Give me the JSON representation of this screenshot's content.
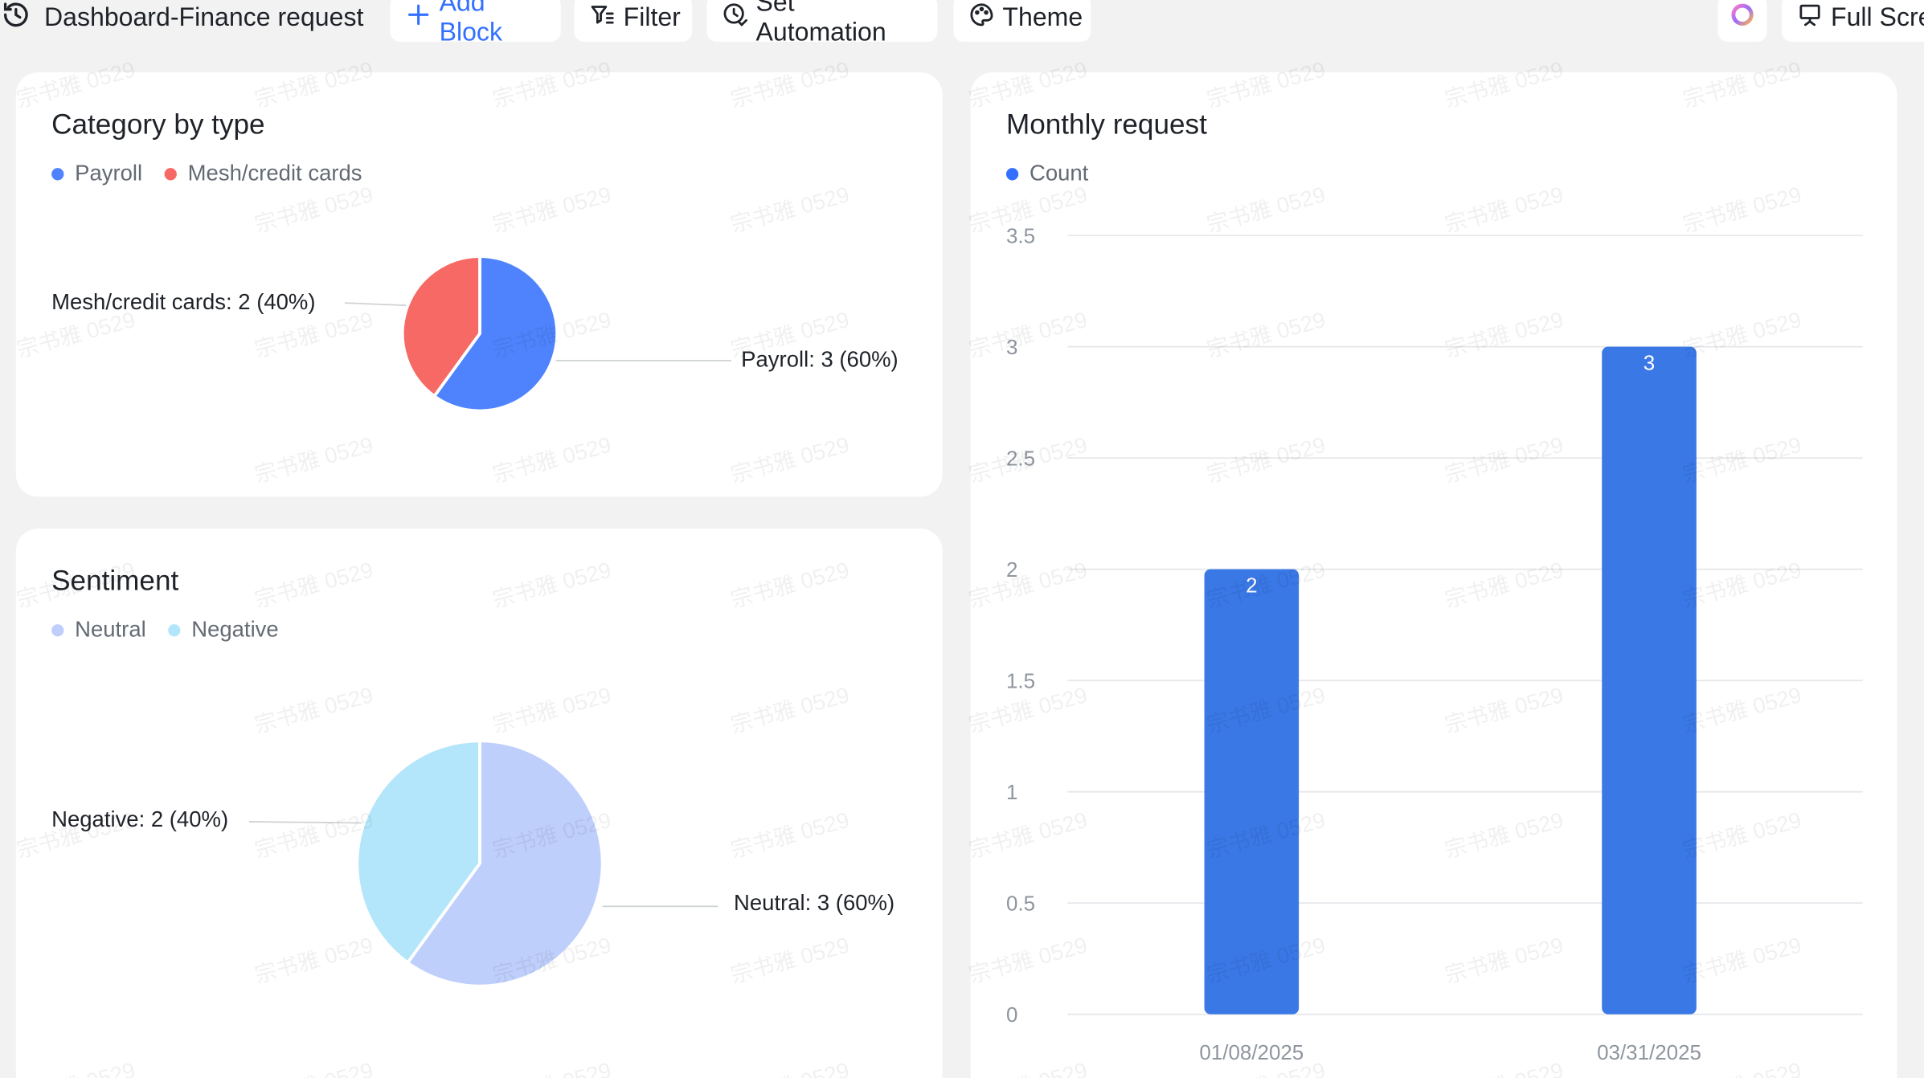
{
  "toolbar": {
    "title": "Dashboard-Finance request",
    "add_block": "Add Block",
    "filter": "Filter",
    "set_automation": "Set Automation",
    "theme": "Theme",
    "full_screen": "Full Scre"
  },
  "watermark": "宗书雅 0529",
  "colors": {
    "accent": "#3370ff",
    "payroll": "#4e83fd",
    "mesh": "#f76964",
    "neutral": "#bfcffb",
    "negative": "#b3e6fa",
    "bar": "#3a78e6"
  },
  "category_card": {
    "title": "Category by type",
    "legend": [
      "Payroll",
      "Mesh/credit cards"
    ],
    "label_mesh": "Mesh/credit cards: 2 (40%)",
    "label_payroll": "Payroll: 3 (60%)"
  },
  "sentiment_card": {
    "title": "Sentiment",
    "legend": [
      "Neutral",
      "Negative"
    ],
    "label_negative": "Negative: 2 (40%)",
    "label_neutral": "Neutral: 3 (60%)"
  },
  "monthly_card": {
    "title": "Monthly request",
    "legend": [
      "Count"
    ]
  },
  "chart_data": [
    {
      "type": "pie",
      "title": "Category by type",
      "categories": [
        "Payroll",
        "Mesh/credit cards"
      ],
      "values": [
        3,
        2
      ],
      "percent": [
        60,
        40
      ],
      "legend": "top-left"
    },
    {
      "type": "pie",
      "title": "Sentiment",
      "categories": [
        "Neutral",
        "Negative"
      ],
      "values": [
        3,
        2
      ],
      "percent": [
        60,
        40
      ],
      "legend": "top-left"
    },
    {
      "type": "bar",
      "title": "Monthly request",
      "categories": [
        "01/08/2025",
        "03/31/2025"
      ],
      "series": [
        {
          "name": "Count",
          "values": [
            2,
            3
          ]
        }
      ],
      "ylim": [
        0,
        3.5
      ],
      "yticks": [
        "0",
        "0.5",
        "1",
        "1.5",
        "2",
        "2.5",
        "3",
        "3.5"
      ],
      "grid": true,
      "legend": "top-left"
    }
  ]
}
